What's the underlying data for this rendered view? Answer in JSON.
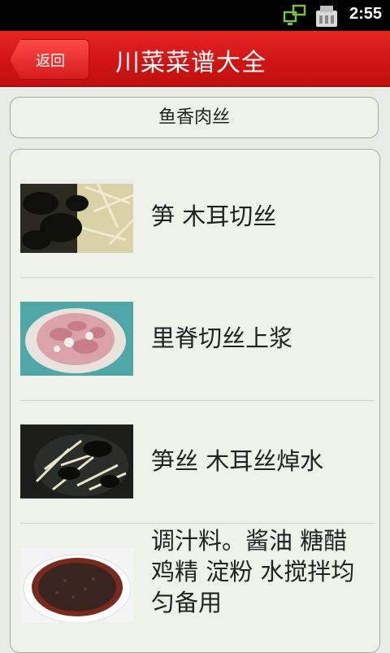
{
  "status": {
    "time": "2:55"
  },
  "header": {
    "back_label": "返回",
    "title": "川菜菜谱大全"
  },
  "dish": {
    "name": "鱼香肉丝"
  },
  "steps": [
    {
      "text": "笋 木耳切丝",
      "image": "bamboo-shoot-and-wood-ear-shreds"
    },
    {
      "text": "里脊切丝上浆",
      "image": "marinated-pork-shreds"
    },
    {
      "text": "笋丝 木耳丝焯水",
      "image": "blanched-shoots-and-wood-ear"
    },
    {
      "text": "调汁料。酱油 糖醋 鸡精 淀粉 水搅拌均匀备用",
      "image": "sauce-in-bowl"
    }
  ]
}
